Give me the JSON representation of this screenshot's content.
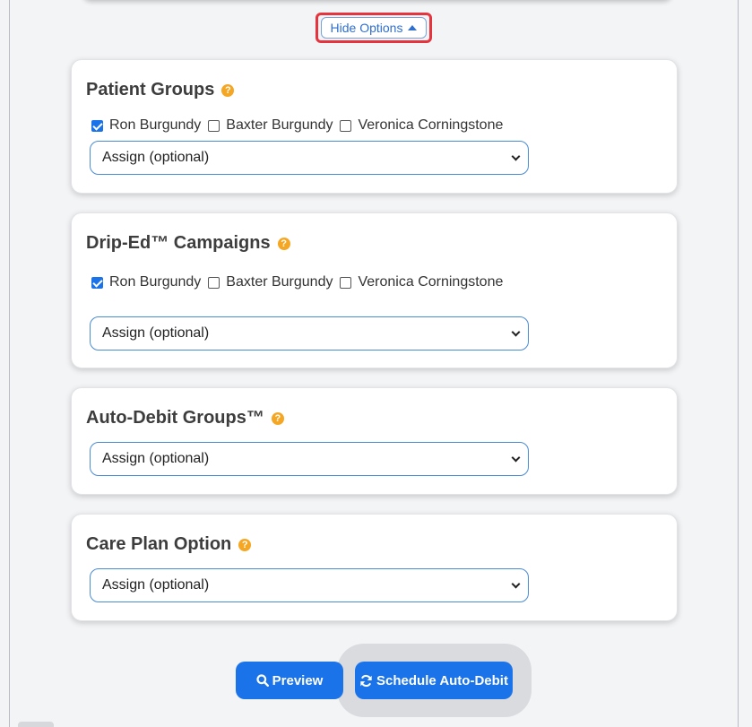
{
  "options_toggle": {
    "label": "Hide Options"
  },
  "patient_groups": {
    "title": "Patient Groups",
    "help_icon": "question-circle-icon",
    "patients": [
      {
        "name": "Ron Burgundy",
        "checked": true
      },
      {
        "name": "Baxter Burgundy",
        "checked": false
      },
      {
        "name": "Veronica Corningstone",
        "checked": false
      }
    ],
    "select_value": "Assign (optional)"
  },
  "drip_campaigns": {
    "title": "Drip-Ed™ Campaigns",
    "help_icon": "question-circle-icon",
    "patients": [
      {
        "name": "Ron Burgundy",
        "checked": true
      },
      {
        "name": "Baxter Burgundy",
        "checked": false
      },
      {
        "name": "Veronica Corningstone",
        "checked": false
      }
    ],
    "select_value": "Assign (optional)"
  },
  "auto_debit_groups": {
    "title": "Auto-Debit Groups™",
    "help_icon": "question-circle-icon",
    "select_value": "Assign (optional)"
  },
  "care_plan": {
    "title": "Care Plan Option",
    "help_icon": "question-circle-icon",
    "select_value": "Assign (optional)"
  },
  "actions": {
    "preview_label": "Preview",
    "preview_icon": "search-icon",
    "schedule_label": "Schedule Auto-Debit",
    "schedule_icon": "refresh-icon"
  },
  "colors": {
    "primary": "#1a73e8",
    "help": "#f5a623",
    "highlight": "#e5343d"
  }
}
